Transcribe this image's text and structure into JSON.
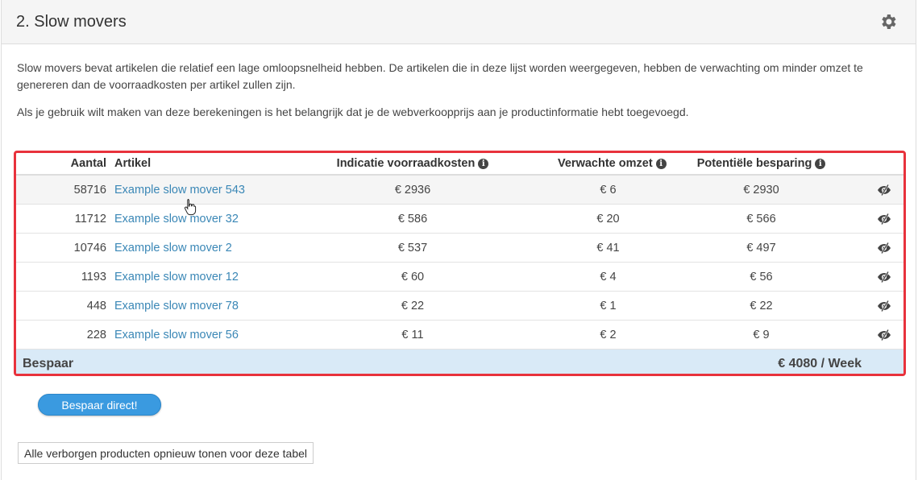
{
  "header": {
    "title": "2. Slow movers",
    "settings_icon": "gear-icon"
  },
  "intro": {
    "p1": "Slow movers bevat artikelen die relatief een lage omloopsnelheid hebben. De artikelen die in deze lijst worden weergegeven, hebben de verwachting om minder omzet te genereren dan de voorraadkosten per artikel zullen zijn.",
    "p2": "Als je gebruik wilt maken van deze berekeningen is het belangrijk dat je de webverkoopprijs aan je productinformatie hebt toegevoegd."
  },
  "table": {
    "headers": {
      "aantal": "Aantal",
      "artikel": "Artikel",
      "voorraadkosten": "Indicatie voorraadkosten",
      "omzet": "Verwachte omzet",
      "besparing": "Potentiële besparing"
    },
    "info_icon": "info-icon",
    "hide_icon": "eye-slash-icon",
    "rows": [
      {
        "aantal": "58716",
        "artikel": "Example slow mover 543",
        "voorraadkosten": "€ 2936",
        "omzet": "€ 6",
        "besparing": "€ 2930"
      },
      {
        "aantal": "11712",
        "artikel": "Example slow mover 32",
        "voorraadkosten": "€ 586",
        "omzet": "€ 20",
        "besparing": "€ 566"
      },
      {
        "aantal": "10746",
        "artikel": "Example slow mover 2",
        "voorraadkosten": "€ 537",
        "omzet": "€ 41",
        "besparing": "€ 497"
      },
      {
        "aantal": "1193",
        "artikel": "Example slow mover 12",
        "voorraadkosten": "€ 60",
        "omzet": "€ 4",
        "besparing": "€ 56"
      },
      {
        "aantal": "448",
        "artikel": "Example slow mover 78",
        "voorraadkosten": "€ 22",
        "omzet": "€ 1",
        "besparing": "€ 22"
      },
      {
        "aantal": "228",
        "artikel": "Example slow mover 56",
        "voorraadkosten": "€ 11",
        "omzet": "€ 2",
        "besparing": "€ 9"
      }
    ],
    "footer": {
      "label": "Bespaar",
      "total": "€ 4080 / Week"
    }
  },
  "actions": {
    "save_button": "Bespaar direct!",
    "show_hidden_button": "Alle verborgen producten opnieuw tonen voor deze tabel"
  },
  "colors": {
    "link": "#3a87b6",
    "highlight_border": "#e8323c",
    "footer_bg": "#d9eaf7",
    "button": "#3a9ae0"
  }
}
